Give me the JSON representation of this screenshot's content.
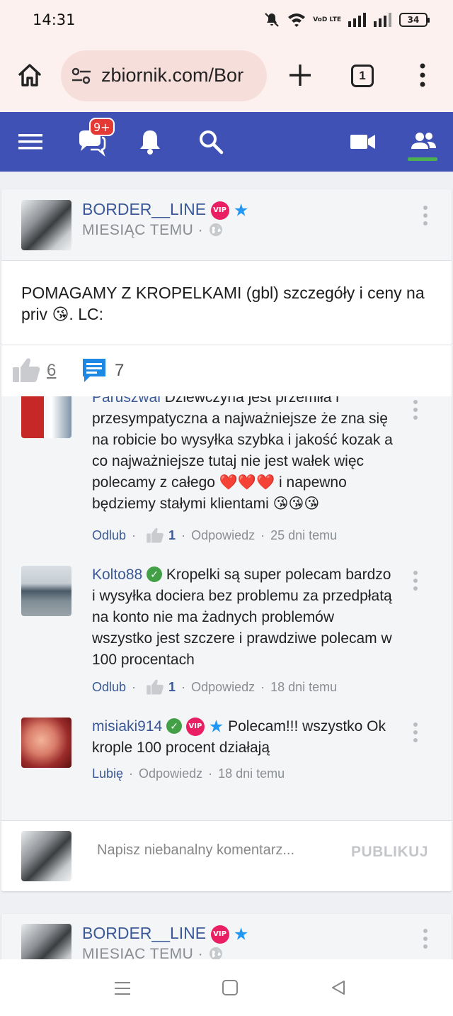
{
  "status_bar": {
    "time": "14:31",
    "volte_label": "VoD LTE",
    "battery": "34"
  },
  "browser": {
    "url": "zbiornik.com/Bor",
    "tab_count": "1"
  },
  "site_nav": {
    "messages_badge": "9+",
    "active_tab": "friends",
    "colors": {
      "bar": "#3f51b5",
      "active_indicator": "#4caf50",
      "badge": "#e53935"
    }
  },
  "post": {
    "author": "BORDER__LINE",
    "vip_label": "VIP",
    "meta": "MIESIĄC TEMU ·",
    "text": "POMAGAMY Z KROPELKAMI (gbl) szczegóły i ceny na priv 😘. LC:",
    "like_count": "6",
    "comment_count": "7"
  },
  "comments": [
    {
      "author": "Paruszwal",
      "text_line1": "Dziewczyna jest przemiła i",
      "text_rest": "przesympatyczna a najważniejsze że zna się na robicie bo wysyłka szybka i jakość kozak a co najważniejsze tutaj nie jest wałek więc polecamy z całego ❤️❤️❤️ i napewno będziemy stałymi klientami 😘😘😘",
      "like_action": "Odlub",
      "likes": "1",
      "reply": "Odpowiedz",
      "time": "25 dni temu"
    },
    {
      "author": "Kolto88",
      "text": "Kropelki są super polecam bardzo i wysyłka dociera bez problemu za przedpłatą na konto nie ma żadnych problemów wszystko jest szczere i prawdziwe polecam w 100 procentach",
      "like_action": "Odlub",
      "likes": "1",
      "reply": "Odpowiedz",
      "time": "18 dni temu"
    },
    {
      "author": "misiaki914",
      "vip_label": "VIP",
      "text": "Polecam!!! wszystko Ok krople 100 procent działają",
      "like_action": "Lubię",
      "reply": "Odpowiedz",
      "time": "18 dni temu"
    }
  ],
  "composer": {
    "placeholder": "Napisz niebanalny komentarz...",
    "publish_label": "PUBLIKUJ"
  },
  "next_post": {
    "author": "BORDER__LINE",
    "vip_label": "VIP",
    "meta": "MIESIĄC TEMU ·"
  }
}
